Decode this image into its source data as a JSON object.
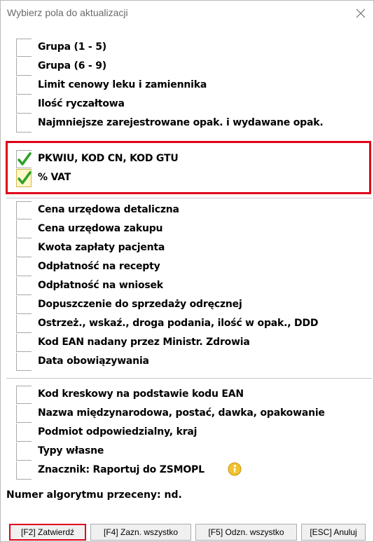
{
  "window": {
    "title": "Wybierz pola do aktualizacji"
  },
  "group1": [
    {
      "label": "Grupa (1 - 5)",
      "checked": false
    },
    {
      "label": "Grupa (6 - 9)",
      "checked": false
    },
    {
      "label": "Limit cenowy leku i zamiennika",
      "checked": false
    },
    {
      "label": "Ilość ryczałtowa",
      "checked": false
    },
    {
      "label": "Najmniejsze zarejestrowane opak. i wydawane opak.",
      "checked": false
    }
  ],
  "group2": [
    {
      "label": "PKWIU, KOD CN, KOD GTU",
      "checked": true
    },
    {
      "label": "% VAT",
      "checked": true
    }
  ],
  "group3": [
    {
      "label": "Cena urzędowa detaliczna",
      "checked": false
    },
    {
      "label": "Cena urzędowa zakupu",
      "checked": false
    },
    {
      "label": "Kwota zapłaty pacjenta",
      "checked": false
    },
    {
      "label": "Odpłatność na recepty",
      "checked": false
    },
    {
      "label": "Odpłatność na wniosek",
      "checked": false
    },
    {
      "label": "Dopuszczenie do sprzedaży odręcznej",
      "checked": false
    },
    {
      "label": "Ostrzeż., wskaź., droga podania, ilość w opak., DDD",
      "checked": false
    },
    {
      "label": "Kod EAN nadany przez Ministr. Zdrowia",
      "checked": false
    },
    {
      "label": "Data obowiązywania",
      "checked": false
    }
  ],
  "group4": [
    {
      "label": "Kod kreskowy na podstawie kodu EAN",
      "checked": false
    },
    {
      "label": "Nazwa międzynarodowa, postać, dawka, opakowanie",
      "checked": false
    },
    {
      "label": "Podmiot odpowiedzialny, kraj",
      "checked": false
    },
    {
      "label": "Typy własne",
      "checked": false
    },
    {
      "label": "Znacznik: Raportuj do ZSMOPL",
      "checked": false,
      "info_icon": "info-icon"
    }
  ],
  "algorithm": {
    "text": "Numer algorytmu przeceny: nd."
  },
  "buttons": [
    {
      "label": "[F2] Zatwierdź",
      "name": "confirm-button"
    },
    {
      "label": "[F4] Zazn. wszystko",
      "name": "select-all-button"
    },
    {
      "label": "[F5] Odzn. wszystko",
      "name": "deselect-all-button"
    },
    {
      "label": "[ESC] Anuluj",
      "name": "cancel-button"
    }
  ],
  "colors": {
    "highlight": "#e0001b",
    "check_green": "#2fa12a"
  }
}
